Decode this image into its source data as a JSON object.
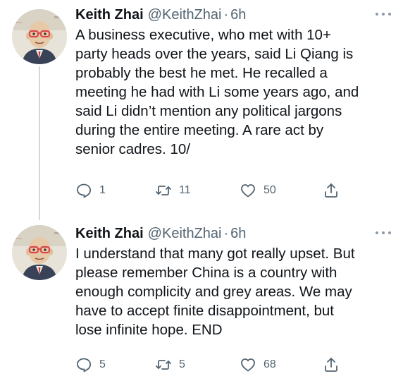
{
  "tweets": [
    {
      "name": "Keith Zhai",
      "handle": "@KeithZhai",
      "separator": "·",
      "time": "6h",
      "lines": [
        "A business executive, who met with 10+",
        "party heads over the years, said Li Qiang is",
        "probably the best he met. He recalled a",
        "meeting he had with Li some years ago, and",
        "said Li didn’t mention any political jargons",
        "during the entire meeting. A rare act by",
        "senior cadres. 10/"
      ],
      "reply_count": "1",
      "retweet_count": "11",
      "like_count": "50"
    },
    {
      "name": "Keith Zhai",
      "handle": "@KeithZhai",
      "separator": "·",
      "time": "6h",
      "lines": [
        "I understand that many got really upset. But",
        "please remember China is a country with",
        "enough complicity and grey areas. We may",
        "have to accept finite disappointment, but",
        "lose infinite hope. END"
      ],
      "reply_count": "5",
      "retweet_count": "5",
      "like_count": "68"
    }
  ],
  "icons": {
    "reply": "reply-icon",
    "retweet": "retweet-icon",
    "like": "heart-icon",
    "share": "share-icon",
    "more": "more-icon"
  },
  "colors": {
    "text": "#0f1419",
    "secondary": "#536471",
    "thread_line": "#cfd9de"
  }
}
